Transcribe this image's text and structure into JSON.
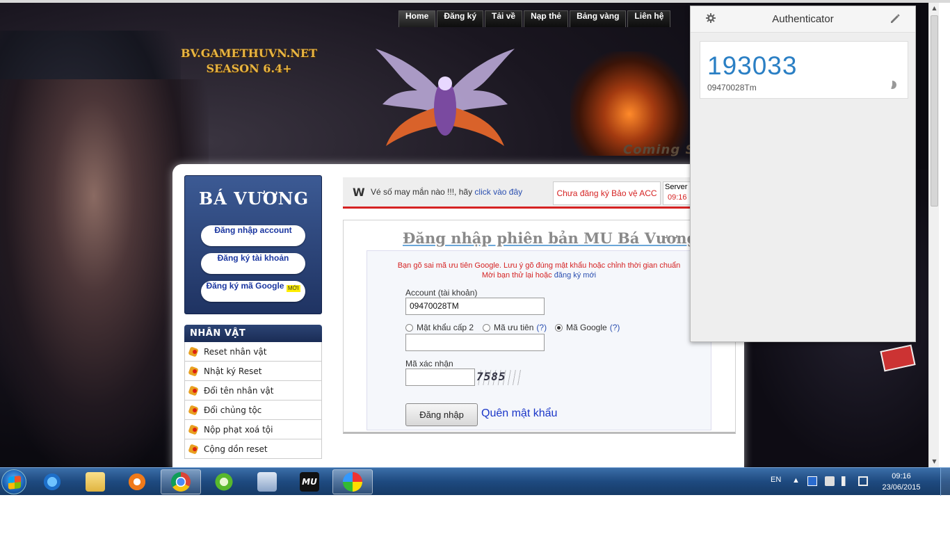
{
  "site": {
    "logo_line1": "BV.GAMETHUVN.NET",
    "logo_line2": "SEASON 6.4+",
    "coming_text": "Coming S"
  },
  "topnav": {
    "items": [
      {
        "label": "Home"
      },
      {
        "label": "Đăng ký"
      },
      {
        "label": "Tải về"
      },
      {
        "label": "Nạp thẻ"
      },
      {
        "label": "Bảng vàng"
      },
      {
        "label": "Liên hệ"
      }
    ]
  },
  "sidebar": {
    "box_title": "BÁ VƯƠNG",
    "login_account": "Đăng nhập account",
    "register_account": "Đăng ký tài khoản",
    "register_google": "Đăng ký mã Google",
    "new_badge": "MỚI",
    "section_title": "NHÂN VẬT",
    "items": [
      {
        "label": "Reset nhân vật"
      },
      {
        "label": "Nhật ký Reset"
      },
      {
        "label": "Đổi tên nhân vật"
      },
      {
        "label": "Đổi chủng tộc"
      },
      {
        "label": "Nộp phạt xoá tội"
      },
      {
        "label": "Cộng dồn reset"
      }
    ]
  },
  "notice": {
    "lottery_text": "Vé số may mắn nào !!!, hãy",
    "lottery_link": "click vào đây",
    "register_protect": "Chưa đăng ký Bảo vệ ACC",
    "server_label": "Server",
    "server_time": "09:16"
  },
  "login": {
    "title": "Đăng nhập phiên bản MU Bá Vương",
    "error_line1": "Bạn gõ sai mã ưu tiên Google. Lưu ý gõ đúng mật khẩu hoặc chỉnh thời gian chuẩn",
    "error_line2": "Mời bạn thử lại hoặc",
    "error_link": "đăng ký mới",
    "account_label": "Account (tài khoản)",
    "account_value": "09470028TM",
    "option_pass2": "Mật khẩu cấp 2",
    "option_priority": "Mã ưu tiên",
    "option_google": "Mã Google",
    "help_mark": "(?)",
    "selected_option": "Mã Google",
    "code_value": "",
    "captcha_label": "Mã xác nhận",
    "captcha_value": "",
    "captcha_image_text": "7585",
    "submit_label": "Đăng nhập",
    "forgot_label": "Quên mật khẩu"
  },
  "authenticator": {
    "title": "Authenticator",
    "code": "193033",
    "account": "09470028Tm"
  },
  "taskbar": {
    "language": "EN",
    "time": "09:16",
    "date": "23/06/2015"
  },
  "colors": {
    "brand_blue": "#1f3362",
    "auth_code": "#2a7fc4",
    "error_red": "#d52222",
    "taskbar": "#1e4a80"
  }
}
